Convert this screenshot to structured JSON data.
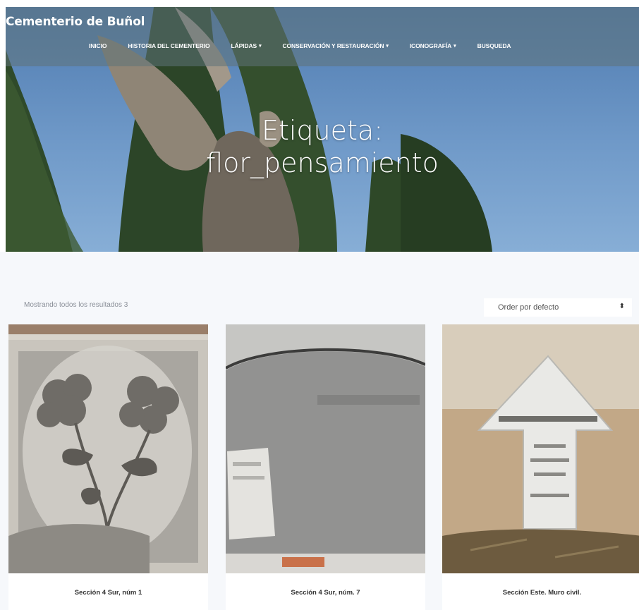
{
  "site": {
    "brand": "Cementerio de Buñol"
  },
  "nav": [
    {
      "label": "INICIO",
      "dropdown": false
    },
    {
      "label": "HISTORIA DEL CEMENTERIO",
      "dropdown": false
    },
    {
      "label": "LÁPIDAS",
      "dropdown": true
    },
    {
      "label": "CONSERVACIÓN Y RESTAURACIÓN",
      "dropdown": true
    },
    {
      "label": "ICONOGRAFÍA",
      "dropdown": true
    },
    {
      "label": "BUSQUEDA",
      "dropdown": false
    }
  ],
  "hero": {
    "title_line1": "Etiqueta:",
    "title_line2": "flor_pensamiento"
  },
  "shop": {
    "result_count": "Mostrando todos los resultados 3",
    "orderby_selected": "Order por defecto"
  },
  "products": [
    {
      "title": "Sección 4 Sur, núm 1",
      "image": "flower-engraving-photo"
    },
    {
      "title": "Sección 4 Sur, núm. 7",
      "image": "gravestone-wall-photo"
    },
    {
      "title": "Sección Este. Muro civil.",
      "image": "arrow-cross-marker-photo"
    }
  ],
  "colors": {
    "header_overlay": "#5f7378",
    "sky": "#5b86bb",
    "background": "#f6f8fb",
    "text": "#333333"
  }
}
